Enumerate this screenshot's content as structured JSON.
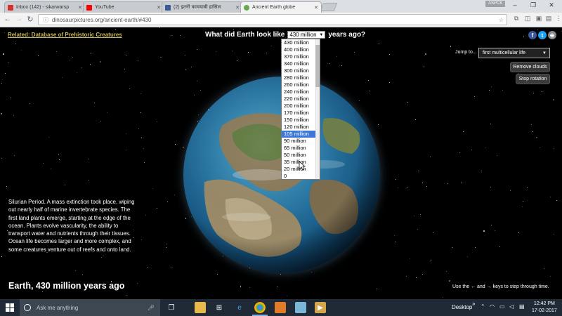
{
  "browser": {
    "tabs": [
      {
        "label": "Inbox (142) - sikarwarsp",
        "favicon_color": "#d93025",
        "favicon_icon": "gmail-icon"
      },
      {
        "label": "YouTube",
        "favicon_color": "#ff0000",
        "favicon_icon": "youtube-icon"
      },
      {
        "label": "(2) इतनी कामयाबी हासिल",
        "favicon_color": "#3b5998",
        "favicon_icon": "facebook-icon"
      },
      {
        "label": "Ancient Earth globe",
        "favicon_color": "#6aa84f",
        "favicon_icon": "globe-icon"
      }
    ],
    "user_badge": "ASPCK",
    "url": "dinosaurpictures.org/ancient-earth/#430"
  },
  "page": {
    "related_link": "Related: Database of Prehistoric Creatures",
    "question_prefix": "What did Earth look like",
    "question_suffix": "years ago?",
    "selected_year": "430 million",
    "year_options": [
      "430 million",
      "400 million",
      "370 million",
      "340 million",
      "300 million",
      "280 million",
      "260 million",
      "240 million",
      "220 million",
      "200 million",
      "170 million",
      "150 million",
      "120 million",
      "105 million",
      "90 million",
      "65 million",
      "50 million",
      "35 million",
      "20 million",
      "0"
    ],
    "highlighted_option": "105 million",
    "jump_label": "Jump to...",
    "jump_value": "first multicellular life",
    "remove_clouds": "Remove clouds",
    "stop_rotation": "Stop rotation",
    "description": "Silurian Period. A mass extinction took place, wiping out nearly half of marine invertebrate species. The first land plants emerge, starting at the edge of the ocean. Plants evolve vascularity, the ability to transport water and nutrients through their tissues. Ocean life becomes larger and more complex, and some creatures venture out of reefs and onto land.",
    "earth_title": "Earth, 430 million years ago",
    "hint": "Use the ← and → keys to step through time."
  },
  "taskbar": {
    "search_placeholder": "Ask me anything",
    "desktop_label": "Desktop",
    "time": "12:42 PM",
    "date": "17-02-2017"
  },
  "colors": {
    "link": "#c9b860",
    "highlight": "#3b78d8",
    "taskbar": "#1f2a36"
  }
}
